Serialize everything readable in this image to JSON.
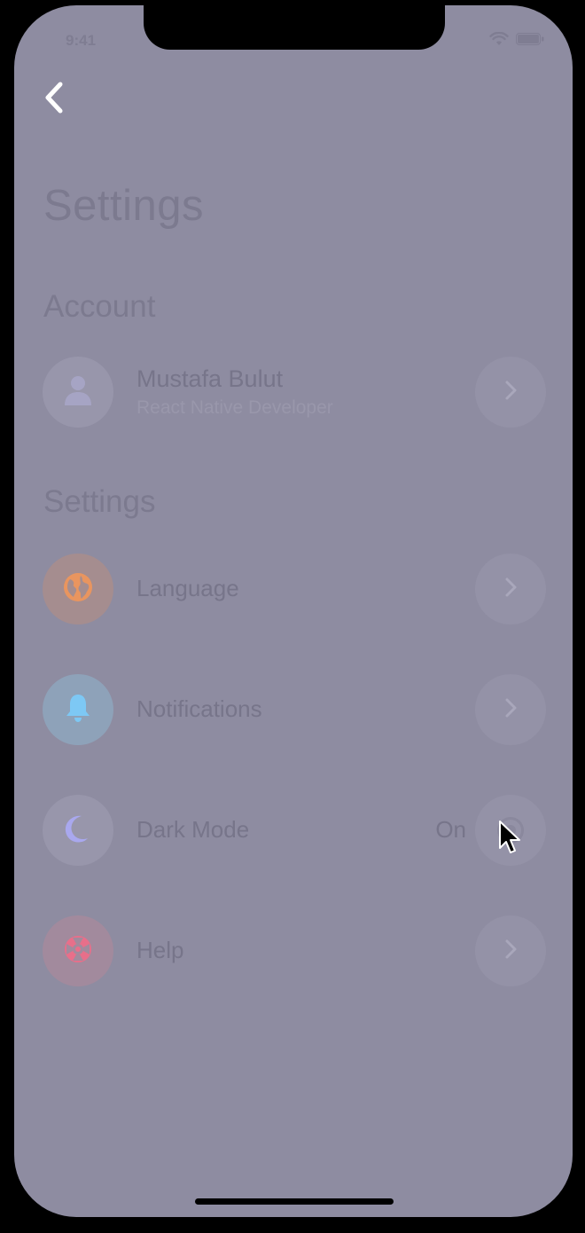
{
  "status_bar": {
    "time": "9:41",
    "wifi_icon": "wifi-icon",
    "battery_icon": "battery-icon"
  },
  "header": {
    "back_icon": "chevron-left-icon",
    "title": "Settings"
  },
  "account_section": {
    "title": "Account",
    "user": {
      "name": "Mustafa Bulut",
      "subtitle": "React Native Developer",
      "avatar_icon": "user-icon",
      "action_icon": "chevron-right-icon"
    }
  },
  "settings_section": {
    "title": "Settings",
    "items": [
      {
        "label": "Language",
        "icon": "globe-icon",
        "icon_color": "#e9955f",
        "circle_color": "#a58d8f",
        "value": "",
        "action_icon": "chevron-right-icon"
      },
      {
        "label": "Notifications",
        "icon": "bell-icon",
        "icon_color": "#7dc8f4",
        "circle_color": "#8ea2b9",
        "value": "",
        "action_icon": "chevron-right-icon"
      },
      {
        "label": "Dark Mode",
        "icon": "moon-icon",
        "icon_color": "#a9a8ee",
        "circle_color": "#9896ab",
        "value": "On",
        "action_icon": "toggle-icon"
      },
      {
        "label": "Help",
        "icon": "lifebuoy-icon",
        "icon_color": "#e86f8a",
        "circle_color": "#a28a9d",
        "value": "",
        "action_icon": "chevron-right-icon"
      }
    ]
  },
  "colors": {
    "screen_background": "#8e8ca1",
    "text": "#77758a",
    "back_icon": "#ffffff"
  }
}
